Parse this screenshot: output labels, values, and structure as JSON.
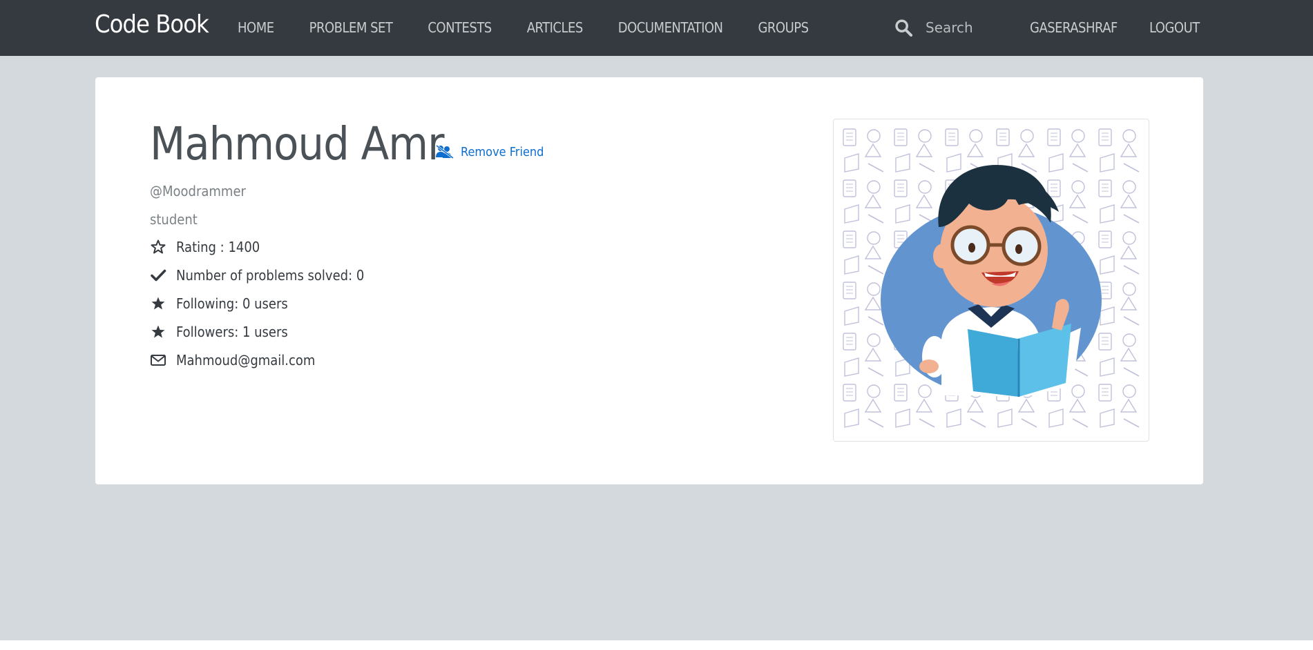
{
  "navbar": {
    "brand": "Code Book",
    "links": [
      {
        "label": "HOME"
      },
      {
        "label": "PROBLEM SET"
      },
      {
        "label": "CONTESTS"
      },
      {
        "label": "ARTICLES"
      },
      {
        "label": "DOCUMENTATION"
      },
      {
        "label": "GROUPS"
      }
    ],
    "search": {
      "placeholder": "Search",
      "icon": "search-icon"
    },
    "username": "GASERASHRAF",
    "logout": "LOGOUT"
  },
  "profile": {
    "name": "Mahmoud Amr",
    "remove_friend": {
      "label": "Remove Friend",
      "icon": "user-remove-icon"
    },
    "handle": "@Moodrammer",
    "role": "student",
    "stats": [
      {
        "icon": "star-outline-icon",
        "label": "Rating : 1400"
      },
      {
        "icon": "check-icon",
        "label": "Number of problems solved: 0"
      },
      {
        "icon": "star-icon",
        "label": "Following: 0 users"
      },
      {
        "icon": "star-icon",
        "label": "Followers: 1 users"
      },
      {
        "icon": "envelope-icon",
        "label": "Mahmoud@gmail.com"
      }
    ]
  },
  "colors": {
    "navbar_bg": "#343a40",
    "page_bg": "#d4d9dd",
    "link_accent": "#0d6ecf",
    "text_dark": "#343a40"
  }
}
